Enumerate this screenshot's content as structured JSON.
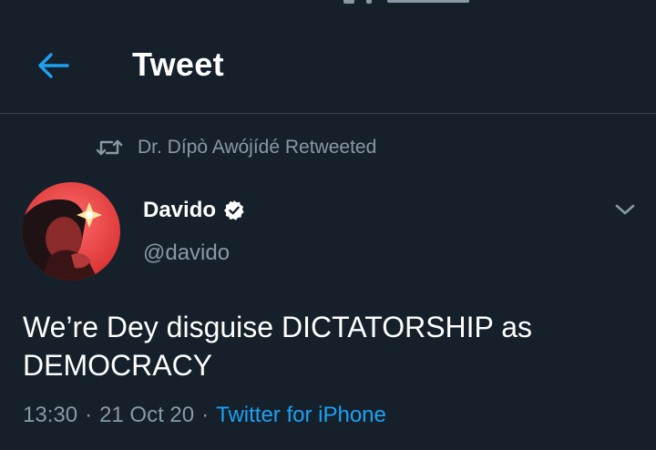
{
  "header": {
    "back_icon": "arrow-left-icon",
    "title": "Tweet"
  },
  "social_context": {
    "icon": "retweet-icon",
    "text": "Dr. Dípò Awójídé Retweeted"
  },
  "tweet": {
    "author": {
      "display_name": "Davido",
      "verified": true,
      "handle": "@davido"
    },
    "text_line_1": "We’re Dey disguise DICTATORSHIP as",
    "text_line_2": "DEMOCRACY",
    "time": "13:30",
    "separator": "·",
    "date": "21 Oct 20",
    "source": "Twitter for iPhone"
  },
  "colors": {
    "background": "#15202b",
    "accent": "#1da1f2",
    "secondary_text": "#8899a6",
    "divider": "#38444d"
  }
}
